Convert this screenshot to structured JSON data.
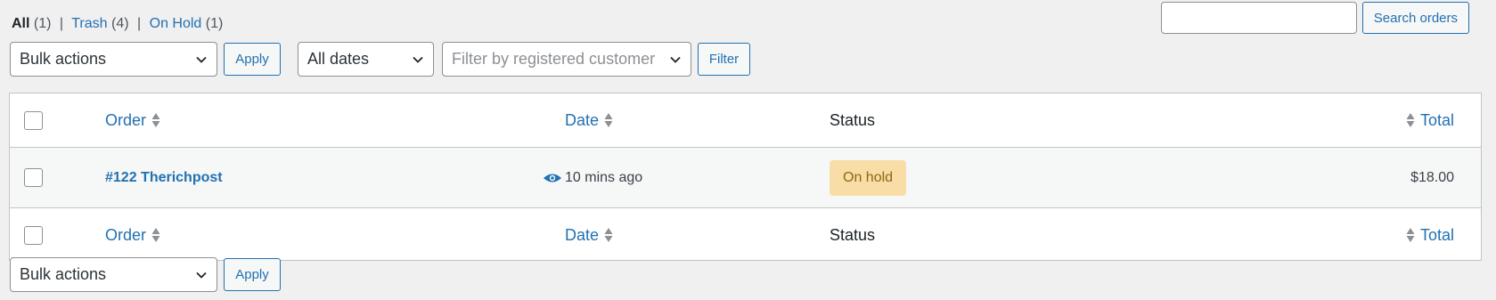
{
  "views": {
    "all_label": "All",
    "all_count": "(1)",
    "trash_label": "Trash",
    "trash_count": "(4)",
    "onhold_label": "On Hold",
    "onhold_count": "(1)",
    "separator": "|"
  },
  "search": {
    "placeholder": "",
    "value": "",
    "button_label": "Search orders"
  },
  "top_actions": {
    "bulk_actions_label": "Bulk actions",
    "apply_label": "Apply",
    "dates_label": "All dates",
    "customer_placeholder": "Filter by registered customer",
    "filter_label": "Filter"
  },
  "table": {
    "columns": {
      "order": "Order",
      "date": "Date",
      "status": "Status",
      "total": "Total"
    },
    "rows": [
      {
        "order": "#122 Therichpost",
        "date": "10 mins ago",
        "status": "On hold",
        "total": "$18.00"
      }
    ]
  },
  "bottom_actions": {
    "bulk_actions_label": "Bulk actions",
    "apply_label": "Apply"
  },
  "colors": {
    "link": "#2271b1",
    "badge_bg": "#f8dda7",
    "badge_text": "#94660c",
    "page_bg": "#f0f0f1"
  },
  "icons": {
    "preview": "eye-icon",
    "sort": "sort-arrows-icon",
    "dropdown": "chevron-down-icon"
  }
}
